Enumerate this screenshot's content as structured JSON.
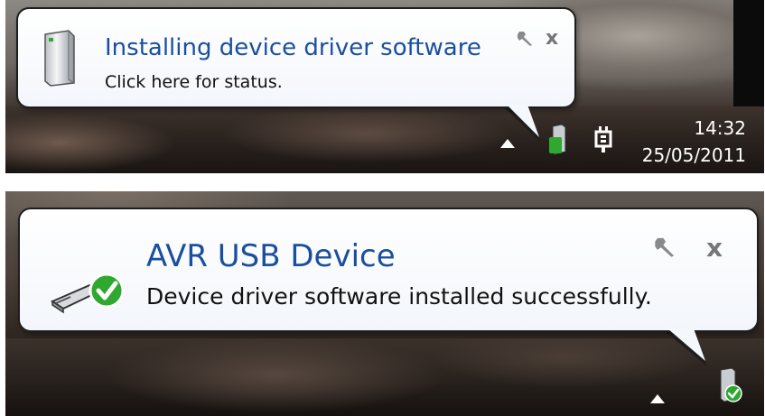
{
  "notifications": [
    {
      "title": "Installing device driver software",
      "subtitle": "Click here for status.",
      "icon": "device-tower-icon"
    },
    {
      "title": "AVR USB Device",
      "subtitle": "Device driver software installed successfully.",
      "icon": "usb-device-checkmark-icon"
    }
  ],
  "balloon_controls": {
    "options_icon": "wrench-icon",
    "close_icon": "close-icon",
    "close_glyph": "x"
  },
  "taskbar": {
    "time": "14:32",
    "date": "25/05/2011",
    "tray_icons": [
      "show-hidden-icons-arrow",
      "device-install-icon",
      "power-plug-icon"
    ]
  },
  "colors": {
    "title_blue": "#1a4f9e",
    "balloon_border": "#1e1e1e",
    "success_green": "#2fa82f"
  }
}
